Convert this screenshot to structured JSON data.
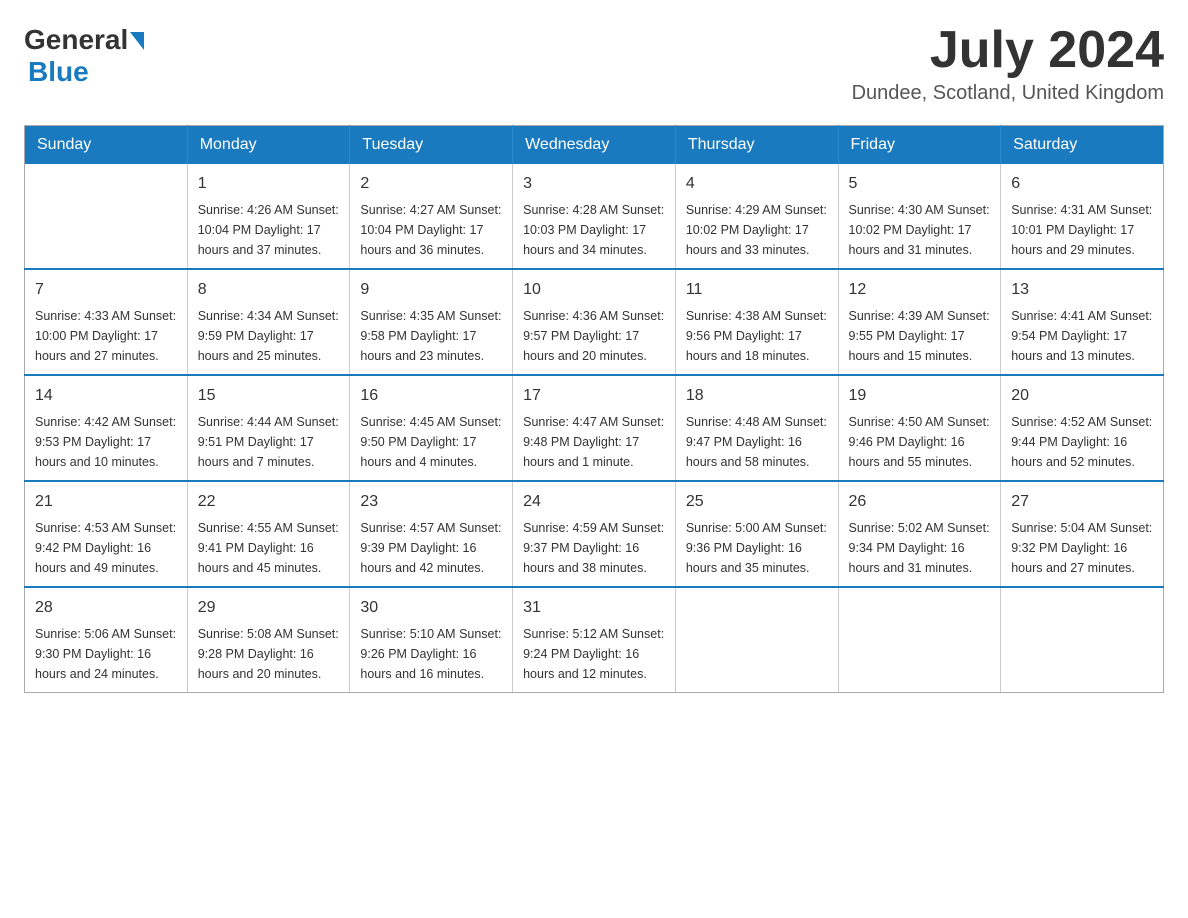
{
  "header": {
    "logo": {
      "general": "General",
      "blue": "Blue"
    },
    "title": "July 2024",
    "location": "Dundee, Scotland, United Kingdom"
  },
  "weekdays": [
    "Sunday",
    "Monday",
    "Tuesday",
    "Wednesday",
    "Thursday",
    "Friday",
    "Saturday"
  ],
  "weeks": [
    [
      {
        "day": "",
        "info": ""
      },
      {
        "day": "1",
        "info": "Sunrise: 4:26 AM\nSunset: 10:04 PM\nDaylight: 17 hours\nand 37 minutes."
      },
      {
        "day": "2",
        "info": "Sunrise: 4:27 AM\nSunset: 10:04 PM\nDaylight: 17 hours\nand 36 minutes."
      },
      {
        "day": "3",
        "info": "Sunrise: 4:28 AM\nSunset: 10:03 PM\nDaylight: 17 hours\nand 34 minutes."
      },
      {
        "day": "4",
        "info": "Sunrise: 4:29 AM\nSunset: 10:02 PM\nDaylight: 17 hours\nand 33 minutes."
      },
      {
        "day": "5",
        "info": "Sunrise: 4:30 AM\nSunset: 10:02 PM\nDaylight: 17 hours\nand 31 minutes."
      },
      {
        "day": "6",
        "info": "Sunrise: 4:31 AM\nSunset: 10:01 PM\nDaylight: 17 hours\nand 29 minutes."
      }
    ],
    [
      {
        "day": "7",
        "info": "Sunrise: 4:33 AM\nSunset: 10:00 PM\nDaylight: 17 hours\nand 27 minutes."
      },
      {
        "day": "8",
        "info": "Sunrise: 4:34 AM\nSunset: 9:59 PM\nDaylight: 17 hours\nand 25 minutes."
      },
      {
        "day": "9",
        "info": "Sunrise: 4:35 AM\nSunset: 9:58 PM\nDaylight: 17 hours\nand 23 minutes."
      },
      {
        "day": "10",
        "info": "Sunrise: 4:36 AM\nSunset: 9:57 PM\nDaylight: 17 hours\nand 20 minutes."
      },
      {
        "day": "11",
        "info": "Sunrise: 4:38 AM\nSunset: 9:56 PM\nDaylight: 17 hours\nand 18 minutes."
      },
      {
        "day": "12",
        "info": "Sunrise: 4:39 AM\nSunset: 9:55 PM\nDaylight: 17 hours\nand 15 minutes."
      },
      {
        "day": "13",
        "info": "Sunrise: 4:41 AM\nSunset: 9:54 PM\nDaylight: 17 hours\nand 13 minutes."
      }
    ],
    [
      {
        "day": "14",
        "info": "Sunrise: 4:42 AM\nSunset: 9:53 PM\nDaylight: 17 hours\nand 10 minutes."
      },
      {
        "day": "15",
        "info": "Sunrise: 4:44 AM\nSunset: 9:51 PM\nDaylight: 17 hours\nand 7 minutes."
      },
      {
        "day": "16",
        "info": "Sunrise: 4:45 AM\nSunset: 9:50 PM\nDaylight: 17 hours\nand 4 minutes."
      },
      {
        "day": "17",
        "info": "Sunrise: 4:47 AM\nSunset: 9:48 PM\nDaylight: 17 hours\nand 1 minute."
      },
      {
        "day": "18",
        "info": "Sunrise: 4:48 AM\nSunset: 9:47 PM\nDaylight: 16 hours\nand 58 minutes."
      },
      {
        "day": "19",
        "info": "Sunrise: 4:50 AM\nSunset: 9:46 PM\nDaylight: 16 hours\nand 55 minutes."
      },
      {
        "day": "20",
        "info": "Sunrise: 4:52 AM\nSunset: 9:44 PM\nDaylight: 16 hours\nand 52 minutes."
      }
    ],
    [
      {
        "day": "21",
        "info": "Sunrise: 4:53 AM\nSunset: 9:42 PM\nDaylight: 16 hours\nand 49 minutes."
      },
      {
        "day": "22",
        "info": "Sunrise: 4:55 AM\nSunset: 9:41 PM\nDaylight: 16 hours\nand 45 minutes."
      },
      {
        "day": "23",
        "info": "Sunrise: 4:57 AM\nSunset: 9:39 PM\nDaylight: 16 hours\nand 42 minutes."
      },
      {
        "day": "24",
        "info": "Sunrise: 4:59 AM\nSunset: 9:37 PM\nDaylight: 16 hours\nand 38 minutes."
      },
      {
        "day": "25",
        "info": "Sunrise: 5:00 AM\nSunset: 9:36 PM\nDaylight: 16 hours\nand 35 minutes."
      },
      {
        "day": "26",
        "info": "Sunrise: 5:02 AM\nSunset: 9:34 PM\nDaylight: 16 hours\nand 31 minutes."
      },
      {
        "day": "27",
        "info": "Sunrise: 5:04 AM\nSunset: 9:32 PM\nDaylight: 16 hours\nand 27 minutes."
      }
    ],
    [
      {
        "day": "28",
        "info": "Sunrise: 5:06 AM\nSunset: 9:30 PM\nDaylight: 16 hours\nand 24 minutes."
      },
      {
        "day": "29",
        "info": "Sunrise: 5:08 AM\nSunset: 9:28 PM\nDaylight: 16 hours\nand 20 minutes."
      },
      {
        "day": "30",
        "info": "Sunrise: 5:10 AM\nSunset: 9:26 PM\nDaylight: 16 hours\nand 16 minutes."
      },
      {
        "day": "31",
        "info": "Sunrise: 5:12 AM\nSunset: 9:24 PM\nDaylight: 16 hours\nand 12 minutes."
      },
      {
        "day": "",
        "info": ""
      },
      {
        "day": "",
        "info": ""
      },
      {
        "day": "",
        "info": ""
      }
    ]
  ]
}
